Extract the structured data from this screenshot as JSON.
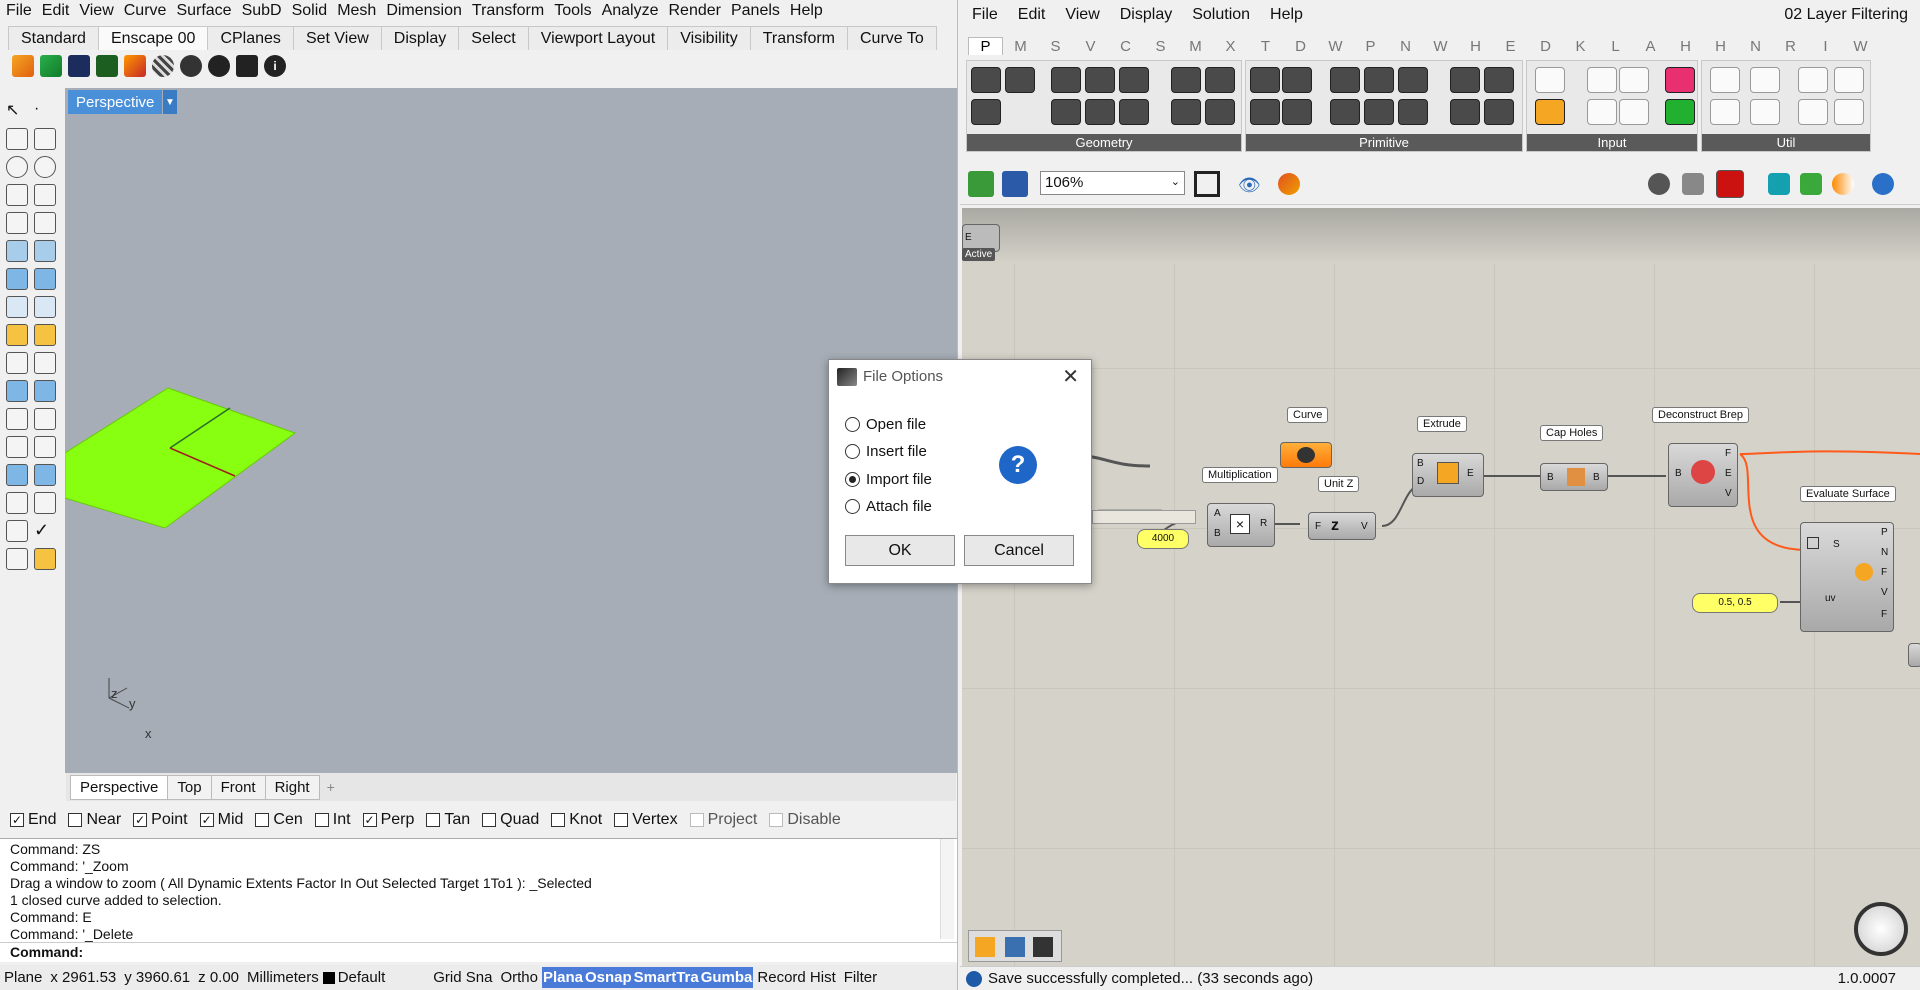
{
  "rhino": {
    "menu": [
      "File",
      "Edit",
      "View",
      "Curve",
      "Surface",
      "SubD",
      "Solid",
      "Mesh",
      "Dimension",
      "Transform",
      "Tools",
      "Analyze",
      "Render",
      "Panels",
      "Help"
    ],
    "tabs": [
      "Standard",
      "Enscape 00",
      "CPlanes",
      "Set View",
      "Display",
      "Select",
      "Viewport Layout",
      "Visibility",
      "Transform",
      "Curve To"
    ],
    "active_tab": "Enscape 00",
    "viewport_title": "Perspective",
    "axis_labels": {
      "z": "z",
      "y": "y",
      "x": "x"
    },
    "viewport_tabs": [
      "Perspective",
      "Top",
      "Front",
      "Right"
    ],
    "osnaps": [
      {
        "label": "End",
        "checked": true
      },
      {
        "label": "Near",
        "checked": false
      },
      {
        "label": "Point",
        "checked": true
      },
      {
        "label": "Mid",
        "checked": true
      },
      {
        "label": "Cen",
        "checked": false
      },
      {
        "label": "Int",
        "checked": false
      },
      {
        "label": "Perp",
        "checked": true
      },
      {
        "label": "Tan",
        "checked": false
      },
      {
        "label": "Quad",
        "checked": false
      },
      {
        "label": "Knot",
        "checked": false
      },
      {
        "label": "Vertex",
        "checked": false
      },
      {
        "label": "Project",
        "checked": false,
        "disabled": true
      },
      {
        "label": "Disable",
        "checked": false,
        "disabled": true
      }
    ],
    "command_history": [
      "Command: ZS",
      "Command: '_Zoom",
      "Drag a window to zoom ( All  Dynamic  Extents  Factor  In  Out  Selected  Target  1To1 ): _Selected",
      "1 closed curve added to selection.",
      "Command: E",
      "Command: '_Delete"
    ],
    "command_prompt": "Command:",
    "status": {
      "plane": "Plane",
      "x": "x 2961.53",
      "y": "y 3960.61",
      "z": "z 0.00",
      "units": "Millimeters",
      "layer": "Default",
      "toggles": [
        "Grid Sna",
        "Ortho",
        "Plana",
        "Osnap",
        "SmartTra",
        "Gumba",
        "Record Hist",
        "Filter"
      ]
    }
  },
  "gh": {
    "menu": [
      "File",
      "Edit",
      "View",
      "Display",
      "Solution",
      "Help"
    ],
    "doc_title": "02 Layer Filtering",
    "tabs": [
      "P",
      "M",
      "S",
      "V",
      "C",
      "S",
      "M",
      "X",
      "T",
      "D",
      "W",
      "P",
      "N",
      "W",
      "H",
      "E",
      "D",
      "K",
      "L",
      "A",
      "H",
      "H",
      "N",
      "R",
      "I",
      "W"
    ],
    "panels": [
      "Geometry",
      "Primitive",
      "Input",
      "Util"
    ],
    "zoom": "106%",
    "components": {
      "active_label": "Active",
      "curve": "Curve",
      "extrude": "Extrude",
      "cap_holes": "Cap Holes",
      "deconstruct_brep": "Deconstruct Brep",
      "multiplication": "Multiplication",
      "unit_z": "Unit Z",
      "evaluate_surface": "Evaluate Surface",
      "number_value": "4000",
      "uv_value": "0.5, 0.5"
    },
    "status_message": "Save successfully completed... (33 seconds ago)",
    "version": "1.0.0007"
  },
  "dialog": {
    "title": "File Options",
    "options": [
      "Open file",
      "Insert file",
      "Import file",
      "Attach file"
    ],
    "selected": "Import file",
    "ok": "OK",
    "cancel": "Cancel"
  }
}
